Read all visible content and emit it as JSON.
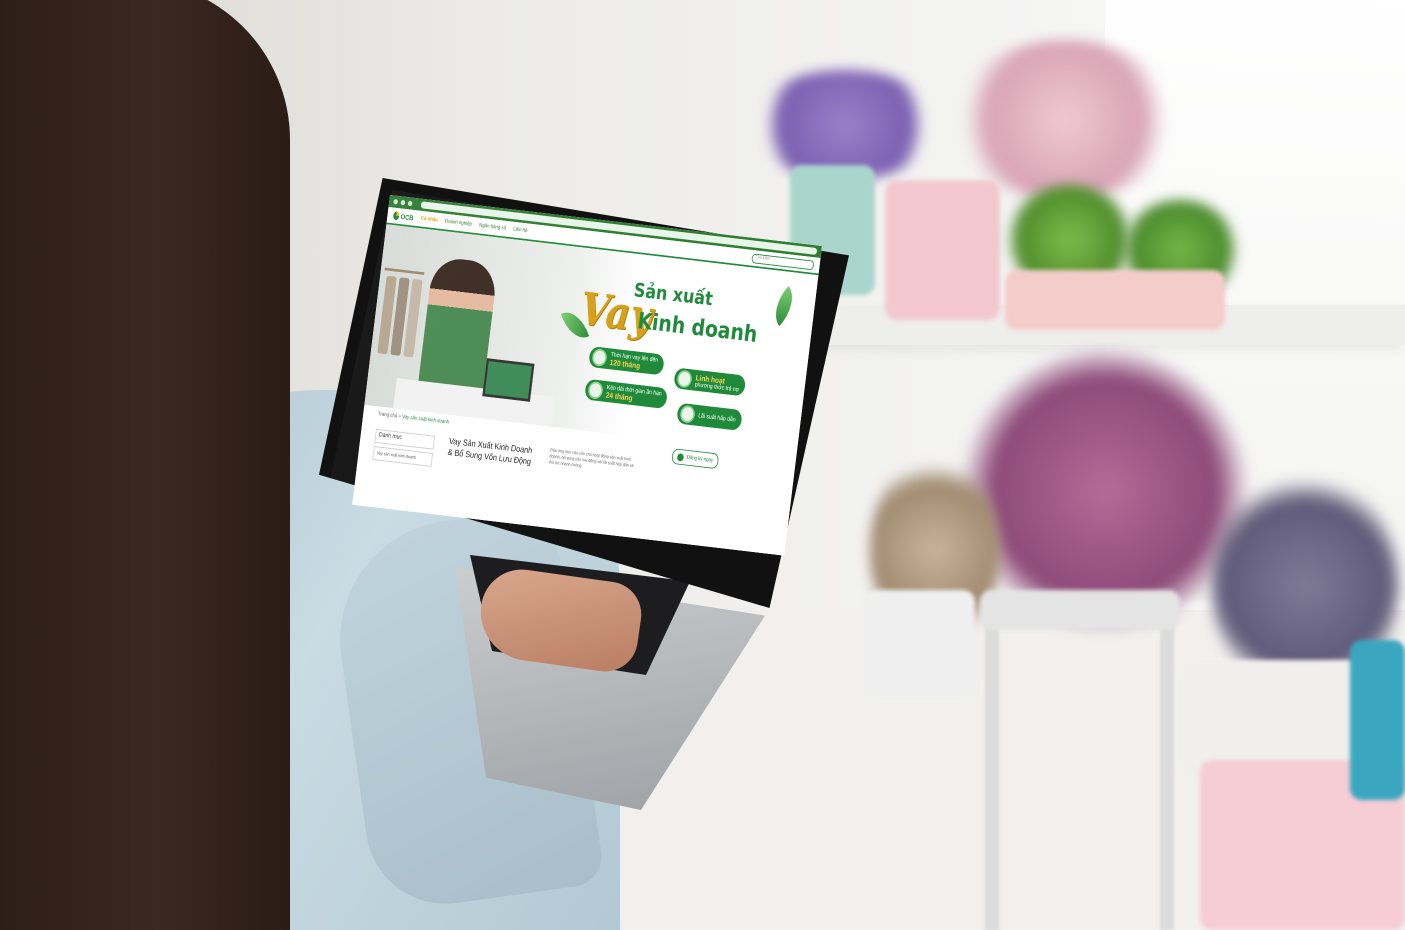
{
  "photo": {
    "subject": "woman using laptop",
    "colors": {
      "brand_green": "#1f8a3a",
      "accent_gold": "#d6a018",
      "wall": "#ecebe8"
    }
  },
  "screen": {
    "logo": "OCB",
    "nav": [
      "Cá nhân",
      "Doanh nghiệp",
      "Ngân hàng số",
      "Liên hệ"
    ],
    "search_placeholder": "Tìm kiếm",
    "hero": {
      "word_vay": "Vay",
      "line1": "Sản xuất",
      "line2": "Kinh doanh",
      "features": [
        {
          "label": "Thời hạn vay lên đến",
          "value": "120 tháng"
        },
        {
          "label": "Linh hoạt",
          "value": "phương thức trả nợ"
        },
        {
          "label": "Kéo dài thời gian ân hạn",
          "value": "24 tháng"
        },
        {
          "label": "Lãi suất",
          "value": "hấp dẫn"
        }
      ]
    },
    "breadcrumb": [
      "Trang chủ",
      "Vay sản xuất kinh doanh"
    ],
    "sidebar": {
      "category": "Danh mục",
      "item": "Vay sản xuất kinh doanh"
    },
    "product_title": "Vay Sản Xuất Kinh Doanh & Bổ Sung Vốn Lưu Động",
    "description": "Đáp ứng nhu cầu vốn cho hoạt động sản xuất kinh doanh, bổ sung vốn lưu động với lãi suất hấp dẫn và thủ tục nhanh chóng.",
    "cta": "Đăng ký ngay"
  }
}
